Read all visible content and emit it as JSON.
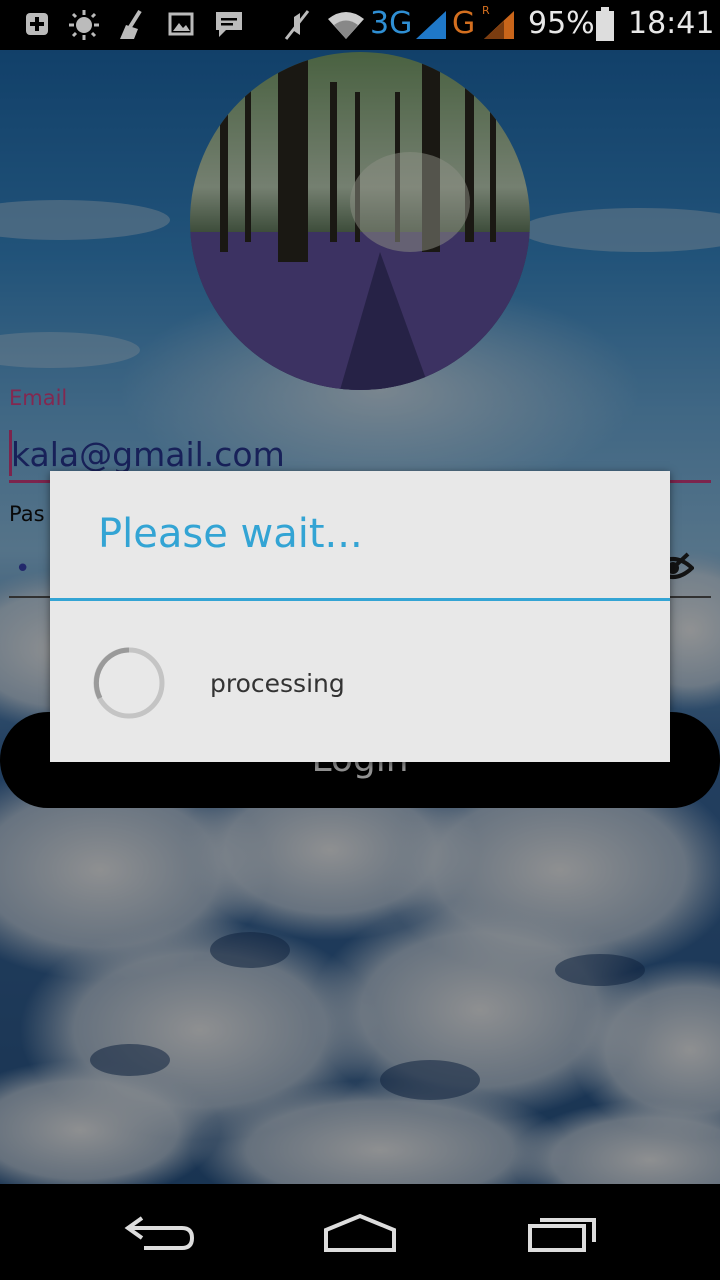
{
  "status_bar": {
    "network_label": "3G",
    "roaming_label": "G",
    "roaming_flag": "R",
    "battery_percent": "95%",
    "time": "18:41",
    "icons": [
      "add-icon",
      "brightness-icon",
      "cleaner-icon",
      "gallery-icon",
      "message-icon",
      "mute-icon",
      "wifi-icon",
      "signal-icon",
      "battery-icon"
    ]
  },
  "login_form": {
    "email_label": "Email",
    "email_value": "kala@gmail.com",
    "password_label": "Pas",
    "password_mask": "• •",
    "login_label": "Login"
  },
  "dialog": {
    "title": "Please wait...",
    "message": "processing"
  },
  "nav_bar": {
    "icons": [
      "back-icon",
      "home-icon",
      "recents-icon"
    ]
  },
  "colors": {
    "accent": "#33a4d4",
    "field_accent": "#d63f86",
    "dialog_bg": "#e8e8e8"
  }
}
